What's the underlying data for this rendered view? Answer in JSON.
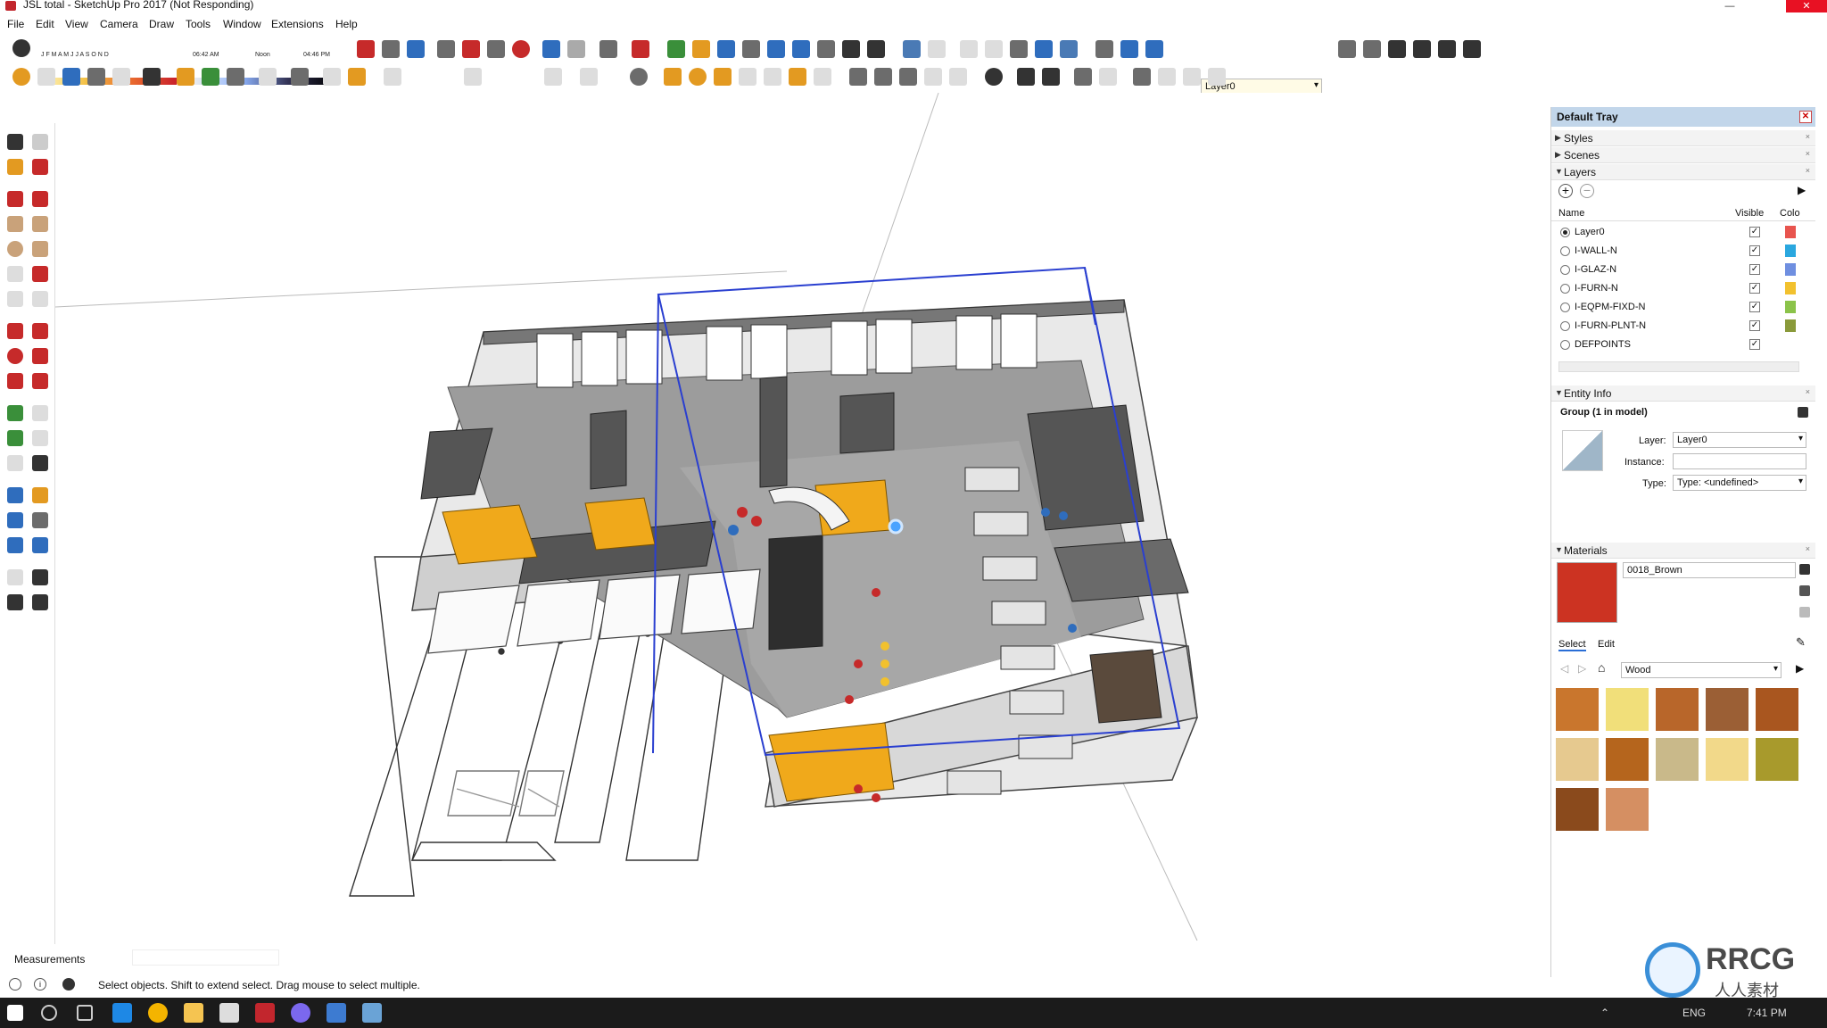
{
  "window": {
    "title": "JSL total - SketchUp Pro 2017 (Not Responding)",
    "minimize": "—",
    "maximize": "☐",
    "close": "✕"
  },
  "menu": [
    "File",
    "Edit",
    "View",
    "Camera",
    "Draw",
    "Tools",
    "Window",
    "Extensions",
    "Help"
  ],
  "toolbar": {
    "shadow_months": "J F M A M J J A S O N D",
    "time_start": "06:42 AM",
    "time_noon": "Noon",
    "time_end": "04:46 PM",
    "active_layer": "Layer0",
    "colors": {
      "red": "#c62a2a",
      "blue": "#2f6dbd",
      "green": "#3a8f3a",
      "orange": "#e39a21",
      "gray": "#6c6c6c",
      "purple": "#6a4aa8"
    }
  },
  "tray": {
    "title": "Default Tray",
    "sections": {
      "styles": "Styles",
      "scenes": "Scenes",
      "layers": "Layers",
      "entity_info": "Entity Info",
      "materials": "Materials"
    },
    "layers_panel": {
      "col_name": "Name",
      "col_visible": "Visible",
      "col_color": "Colo",
      "rows": [
        {
          "name": "Layer0",
          "active": true,
          "visible": true,
          "color": "#e8544e"
        },
        {
          "name": "I-WALL-N",
          "active": false,
          "visible": true,
          "color": "#2aa7df"
        },
        {
          "name": "I-GLAZ-N",
          "active": false,
          "visible": true,
          "color": "#6f8fe0"
        },
        {
          "name": "I-FURN-N",
          "active": false,
          "visible": true,
          "color": "#f2c12e"
        },
        {
          "name": "I-EQPM-FIXD-N",
          "active": false,
          "visible": true,
          "color": "#8bc34a"
        },
        {
          "name": "I-FURN-PLNT-N",
          "active": false,
          "visible": true,
          "color": "#8a9a3a"
        },
        {
          "name": "DEFPOINTS",
          "active": false,
          "visible": true,
          "color": "#ffffff"
        }
      ]
    },
    "entity_info": {
      "heading": "Group (1 in model)",
      "layer_label": "Layer:",
      "layer_value": "Layer0",
      "instance_label": "Instance:",
      "instance_value": "",
      "type_label": "Type:",
      "type_value": "Type: <undefined>"
    },
    "materials": {
      "current_name": "0018_Brown",
      "current_color": "#cc3322",
      "tab_select": "Select",
      "tab_edit": "Edit",
      "library": "Wood",
      "swatches": [
        "#c9762d",
        "#f1df7a",
        "#b8662a",
        "#9b5f35",
        "#a9561f",
        "#e6c98f",
        "#b5651d",
        "#c9b98a",
        "#f2d98a",
        "#a89a2c",
        "#8a4a1c",
        "#d58f62"
      ]
    }
  },
  "measurements_label": "Measurements",
  "status_text": "Select objects. Shift to extend select. Drag mouse to select multiple.",
  "taskbar": {
    "lang": "ENG",
    "time": "7:41 PM"
  },
  "watermark": {
    "brand": "RRCG",
    "sub": "人人素材"
  }
}
